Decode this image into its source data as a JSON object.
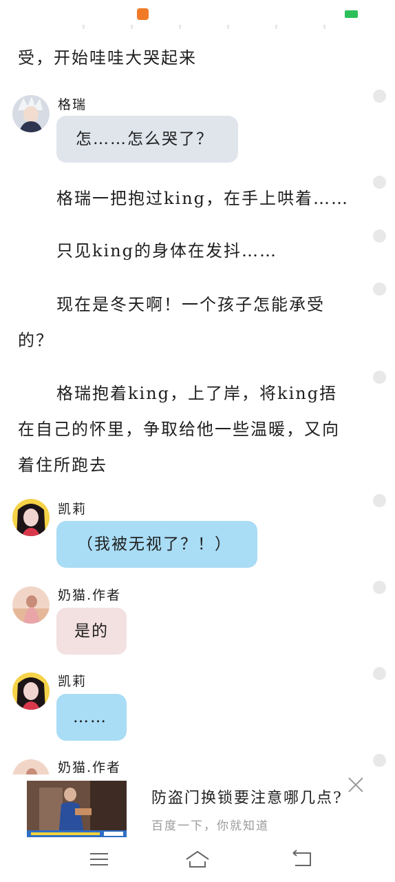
{
  "status_bar": {
    "app_icon": "app-notification-icon",
    "battery": "battery-icon"
  },
  "content": {
    "para_top": "受，开始哇哇大哭起来",
    "p1": "格瑞一把抱过king，在手上哄着……",
    "p2": "只见king的身体在发抖……",
    "p3": "现在是冬天啊！一个孩子怎能承受的？",
    "p4": "格瑞抱着king，上了岸，将king捂在自己的怀里，争取给他一些温暖，又向着住所跑去"
  },
  "dialogs": [
    {
      "speaker": "格瑞",
      "text": "怎……怎么哭了？"
    },
    {
      "speaker": "凯莉",
      "text": "（我被无视了？！）"
    },
    {
      "speaker": "奶猫.作者",
      "text": "是的"
    },
    {
      "speaker": "凯莉",
      "text": "……"
    },
    {
      "speaker": "奶猫.作者",
      "text": ""
    }
  ],
  "ad": {
    "title": "防盗门换锁要注意哪几点?",
    "subtitle": "百度一下，你就知道",
    "close_icon": "close-icon"
  },
  "navbar": {
    "menu_icon": "menu-icon",
    "home_icon": "home-icon",
    "back_icon": "back-icon"
  },
  "colors": {
    "bubble_grey": "#e0e5ec",
    "bubble_blue": "#a9dcf5",
    "bubble_pink": "#f3e0e0",
    "status_accent": "#f07a26"
  }
}
